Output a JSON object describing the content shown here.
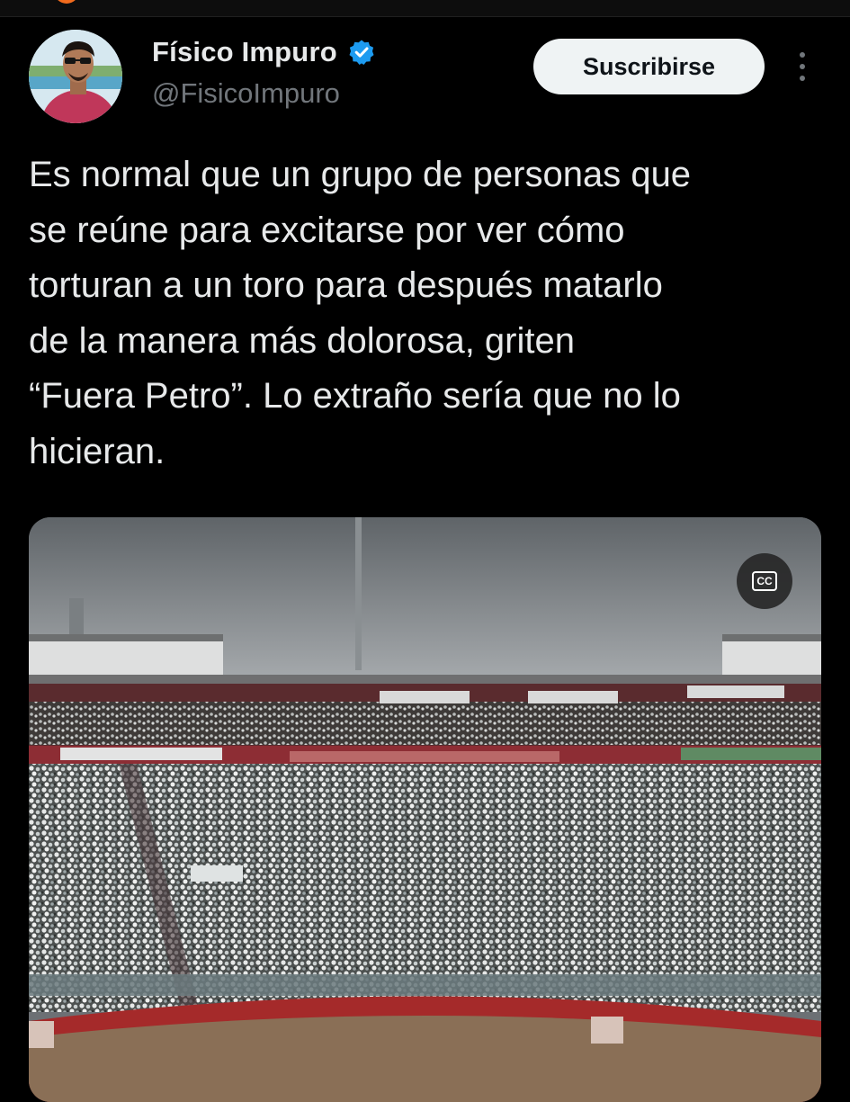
{
  "author": {
    "name": "Físico Impuro",
    "handle": "@FisicoImpuro",
    "verified": true
  },
  "actions": {
    "subscribe_label": "Suscribirse",
    "more_icon": "more-vertical-icon"
  },
  "tweet": {
    "text": "Es normal que un grupo de personas que\nse reúne para excitarse por ver cómo\ntorturan a un toro para después matarlo\nde la manera más dolorosa, griten\n“Fuera Petro”. Lo extraño sería que no lo\nhicieran."
  },
  "media": {
    "type": "video",
    "cc_label": "CC"
  },
  "colors": {
    "background": "#000000",
    "text": "#e7e9ea",
    "secondary_text": "#71767b",
    "verified_blue": "#1d9bf0",
    "button_bg": "#eff3f4",
    "button_text": "#0f1419"
  }
}
